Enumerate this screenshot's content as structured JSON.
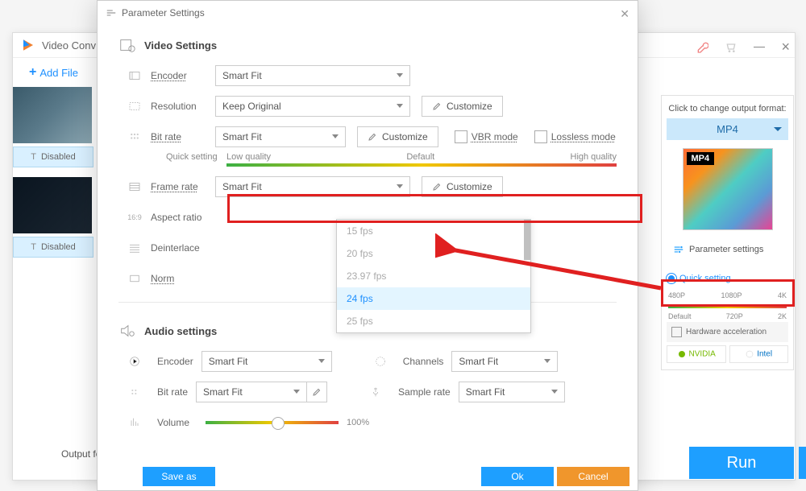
{
  "app": {
    "title": "Video Conv",
    "addFiles": "Add File",
    "outputFolder": "Output folder:"
  },
  "thumbs": {
    "disabled": "Disabled"
  },
  "side": {
    "clickLabel": "Click to change output format:",
    "format": "MP4",
    "paramBtn": "Parameter settings",
    "quick": "Quick setting",
    "q": {
      "p480": "480P",
      "p1080": "1080P",
      "p4k": "4K",
      "def": "Default",
      "p720": "720P",
      "p2k": "2K"
    },
    "hw": "Hardware acceleration",
    "nvidia": "NVIDIA",
    "intel": "Intel",
    "run": "Run"
  },
  "modal": {
    "title": "Parameter Settings",
    "videoSection": "Video Settings",
    "audioSection": "Audio settings",
    "encoder": "Encoder",
    "resolution": "Resolution",
    "bitrate": "Bit rate",
    "framerate": "Frame rate",
    "aspect": "Aspect ratio",
    "deinterlace": "Deinterlace",
    "norm": "Norm",
    "channels": "Channels",
    "samplerate": "Sample rate",
    "volume": "Volume",
    "customize": "Customize",
    "vbr": "VBR mode",
    "lossless": "Lossless mode",
    "quickSetting": "Quick setting",
    "lowQ": "Low quality",
    "default": "Default",
    "highQ": "High quality",
    "volPercent": "100%",
    "saveAs": "Save as",
    "ok": "Ok",
    "cancel": "Cancel",
    "values": {
      "encoder": "Smart Fit",
      "resolution": "Keep Original",
      "bitrate": "Smart Fit",
      "framerate": "Smart Fit",
      "audioEncoder": "Smart Fit",
      "audioBitrate": "Smart Fit",
      "channels": "Smart Fit",
      "samplerate": "Smart Fit"
    },
    "fps": {
      "a": "15 fps",
      "b": "20 fps",
      "c": "23.97 fps",
      "d": "24 fps",
      "e": "25 fps"
    }
  }
}
